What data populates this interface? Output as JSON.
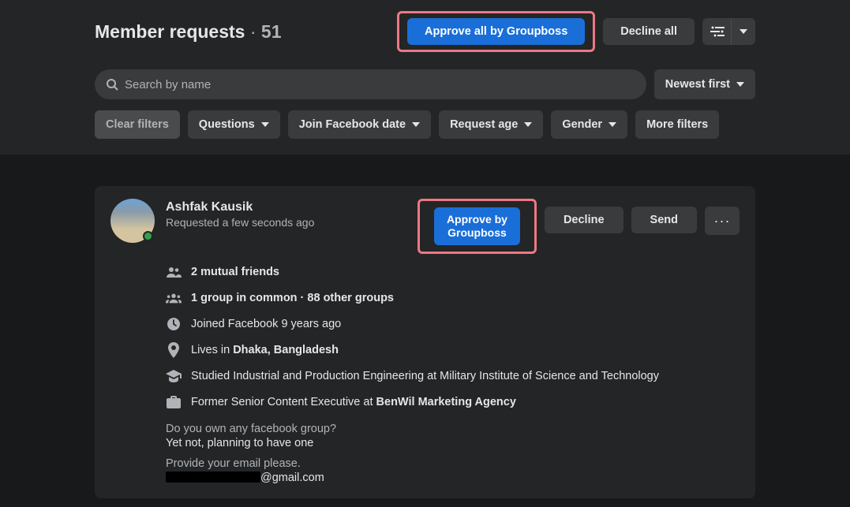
{
  "header": {
    "title": "Member requests",
    "separator": "·",
    "count": "51",
    "approve_all": "Approve all by Groupboss",
    "decline_all": "Decline all"
  },
  "search": {
    "placeholder": "Search by name"
  },
  "sort": {
    "label": "Newest first"
  },
  "filters": {
    "clear": "Clear filters",
    "questions": "Questions",
    "join_date": "Join Facebook date",
    "request_age": "Request age",
    "gender": "Gender",
    "more": "More filters"
  },
  "request": {
    "name": "Ashfak Kausik",
    "requested": "Requested a few seconds ago",
    "approve_btn": "Approve by\nGroupboss",
    "decline": "Decline",
    "send": "Send",
    "mutual_friends": "2 mutual friends",
    "groups": "1 group in common · 88 other groups",
    "joined": "Joined Facebook 9 years ago",
    "lives_prefix": "Lives in ",
    "lives_place": "Dhaka, Bangladesh",
    "education": "Studied Industrial and Production Engineering at Military Institute of Science and Technology",
    "work_prefix": "Former Senior Content Executive at ",
    "work_place": "BenWil Marketing Agency",
    "q1": "Do you own any facebook group?",
    "a1": "Yet not, planning to have one",
    "q2": "Provide your email please.",
    "a2_suffix": "@gmail.com"
  }
}
